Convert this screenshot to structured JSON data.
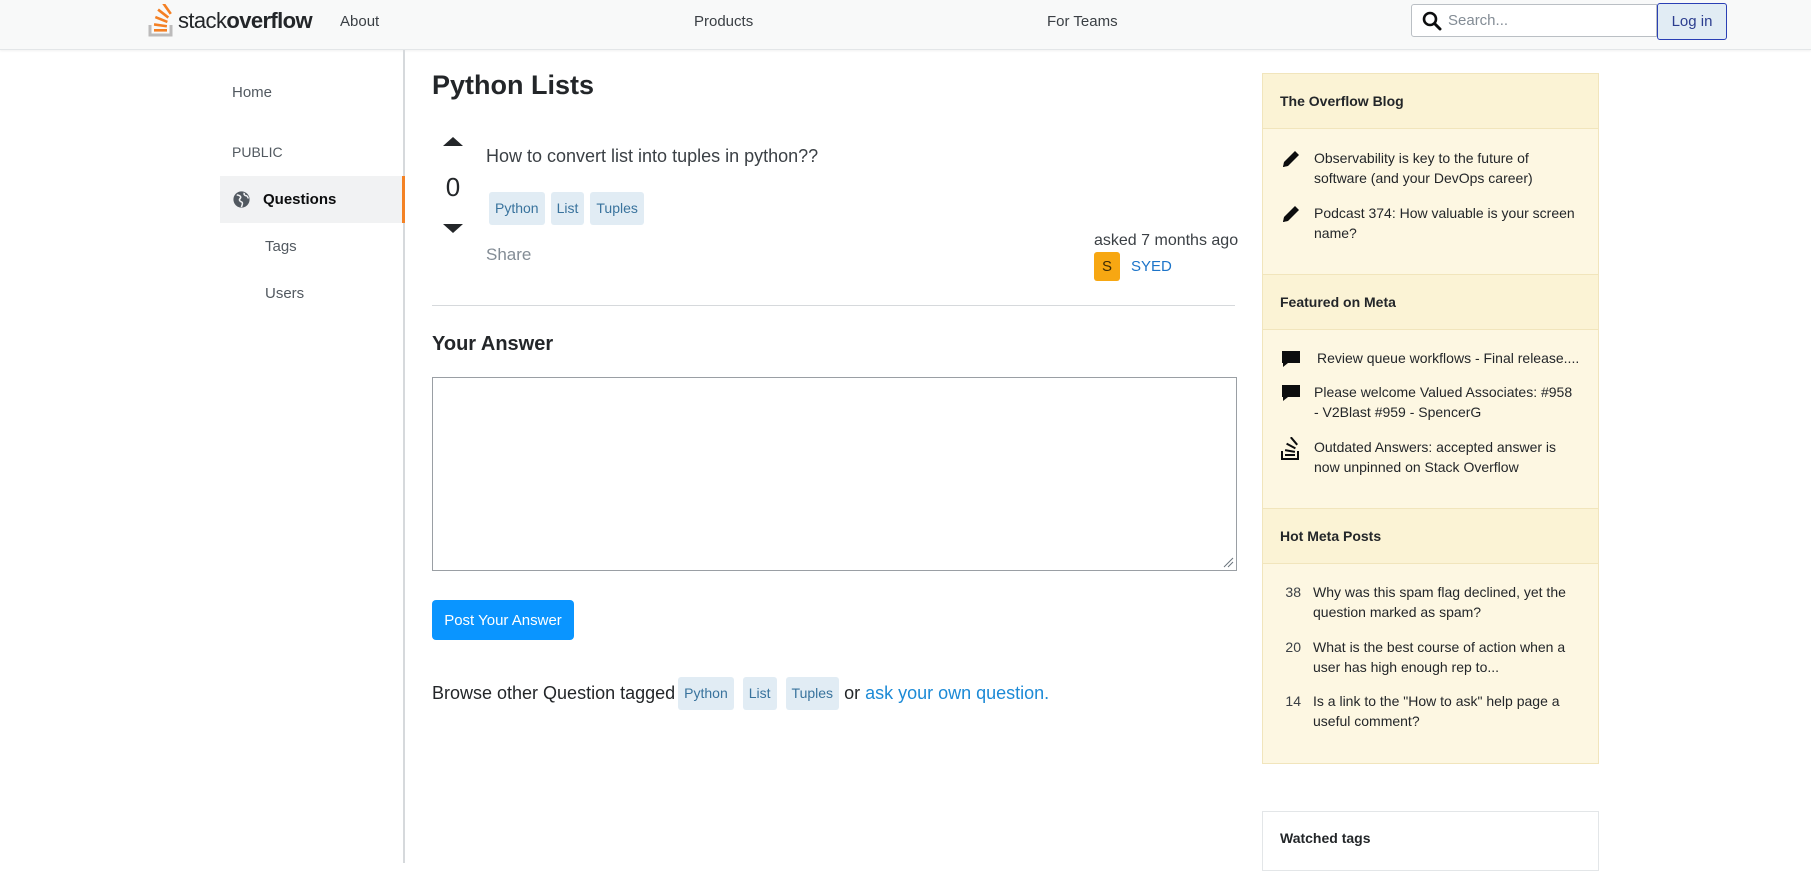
{
  "header": {
    "logo_text_light": "stack",
    "logo_text_bold": "overflow",
    "nav": [
      "About",
      "Products",
      "For Teams"
    ],
    "search_placeholder": "Search...",
    "login_label": "Log in"
  },
  "sidebar": {
    "home": "Home",
    "section": "PUBLIC",
    "active": "Questions",
    "items": [
      "Tags",
      "Users"
    ]
  },
  "question": {
    "page_title": "Python Lists",
    "votes": "0",
    "title": "How to convert list into tuples in python??",
    "tags": [
      "Python",
      "List",
      "Tuples"
    ],
    "share": "Share",
    "asked": "asked 7 months ago",
    "user_initial": "S",
    "user_name": "SYED"
  },
  "answer": {
    "heading": "Your Answer",
    "textarea_value": "",
    "post_button": "Post Your Answer"
  },
  "browse": {
    "prefix": "Browse other Question tagged",
    "tags": [
      "Python",
      "List",
      "Tuples"
    ],
    "or": "or",
    "link": "ask your own question."
  },
  "right_sidebar": {
    "blog": {
      "heading": "The Overflow Blog",
      "items": [
        {
          "icon": "pencil-icon",
          "text": "Observability is key to the future of software (and your DevOps career)"
        },
        {
          "icon": "pencil-icon",
          "text": "Podcast 374: How valuable is your screen name?"
        }
      ]
    },
    "meta": {
      "heading": "Featured on Meta",
      "items": [
        {
          "icon": "comment-icon",
          "text": "Review queue workflows - Final release...."
        },
        {
          "icon": "comment-icon",
          "text": "Please welcome Valued Associates: #958 - V2Blast #959 - SpencerG"
        },
        {
          "icon": "stack-icon",
          "text": "Outdated Answers: accepted answer is now unpinned on Stack Overflow"
        }
      ]
    },
    "hot": {
      "heading": "Hot Meta Posts",
      "items": [
        {
          "count": "38",
          "text": "Why was this spam flag declined, yet the question marked as spam?"
        },
        {
          "count": "20",
          "text": "What is the best course of action when a user has high enough rep to..."
        },
        {
          "count": "14",
          "text": "Is a link to the \"How to ask\" help page a useful comment?"
        }
      ]
    },
    "watched": "Watched tags"
  },
  "colors": {
    "accent": "#f48225",
    "primary_button": "#0a95ff",
    "tag_bg": "#e1ecf4",
    "tag_text": "#39739d",
    "widget_bg": "#fdf7e2"
  }
}
